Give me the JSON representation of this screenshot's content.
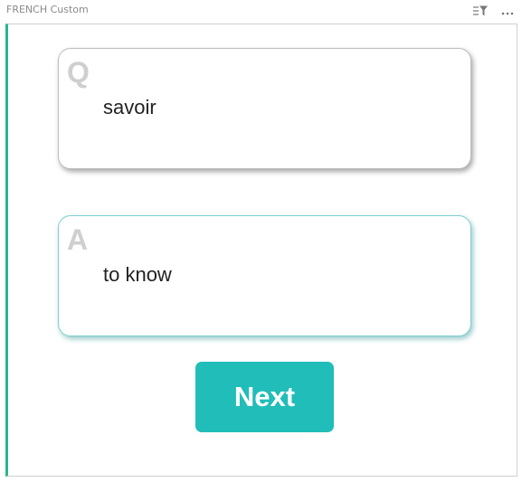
{
  "window": {
    "title": "FRENCH Custom",
    "icons": [
      "filter-icon",
      "more-icon"
    ]
  },
  "colors": {
    "accent": "#21bdb9",
    "left_stripe": "#2cb58f",
    "letter": "#cfcfcf"
  },
  "question": {
    "letter": "Q",
    "text": "savoir"
  },
  "answer": {
    "letter": "A",
    "text": "to know"
  },
  "next_button": {
    "label": "Next"
  }
}
